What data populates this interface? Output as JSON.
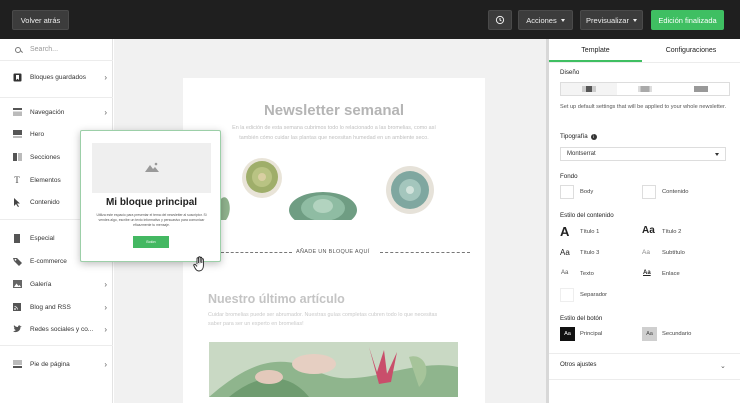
{
  "topbar": {
    "back_label": "Volver atrás",
    "actions_label": "Acciones",
    "preview_label": "Previsualizar",
    "finish_label": "Edición finalizada",
    "history_icon": "history-icon"
  },
  "sidebar": {
    "search_placeholder": "Search...",
    "items": [
      {
        "label": "Bloques guardados",
        "icon": "bookmark-icon"
      },
      {
        "label": "Navegación",
        "icon": "navigation-icon"
      },
      {
        "label": "Hero",
        "icon": "hero-icon"
      },
      {
        "label": "Secciones",
        "icon": "sections-icon"
      },
      {
        "label": "Elementos",
        "icon": "text-icon"
      },
      {
        "label": "Contenido",
        "icon": "cursor-icon"
      },
      {
        "label": "Especial",
        "icon": "special-icon"
      },
      {
        "label": "E-commerce",
        "icon": "tag-icon"
      },
      {
        "label": "Galería",
        "icon": "gallery-icon"
      },
      {
        "label": "Blog and RSS",
        "icon": "rss-icon"
      },
      {
        "label": "Redes sociales y co...",
        "icon": "twitter-icon"
      },
      {
        "label": "Pie de página",
        "icon": "footer-icon"
      }
    ]
  },
  "canvas": {
    "newsletter_title": "Newsletter semanal",
    "newsletter_text": "En la edición de esta semana cubrimos todo lo relacionado a las bromelias, como así también cómo cuidar las plantas que necesitan humedad en un ambiente seco.",
    "add_block_label": "AÑADE UN BLOQUE AQUÍ",
    "article_title": "Nuestro último artículo",
    "article_text": "Cuidar bromelias puede ser abrumador. Nuestras guías completas cubren todo lo que necesitas saber para ser un experto en bromelias!"
  },
  "popover": {
    "title": "Mi bloque principal",
    "text": "Utiliza este espacio para presentar el tema del newsletter al suscriptor. Si vendes algo, escribe un texto informativo y persuasivo para comunicar eficazmente tu mensaje.",
    "button_label": "Botón"
  },
  "panel": {
    "tabs": [
      "Template",
      "Configuraciones"
    ],
    "design_label": "Diseño",
    "design_text": "Set up default settings that will be applied to your whole newsletter.",
    "typography_label": "Tipografía",
    "font_value": "Montserrat",
    "background_label": "Fondo",
    "bg_body": "Body",
    "bg_content": "Contenido",
    "content_style_label": "Estilo del contenido",
    "styles": {
      "title1": "Título 1",
      "title2": "Título 2",
      "title3": "Título 3",
      "subtitle": "Subtítulo",
      "text": "Texto",
      "link": "Enlace",
      "separator": "Separador"
    },
    "button_style_label": "Estilo del botón",
    "btn_primary": "Principal",
    "btn_secondary": "Secundario",
    "other_settings": "Otros ajustes"
  },
  "colors": {
    "accent": "#3fbf62",
    "topbar": "#1f1f1f"
  }
}
